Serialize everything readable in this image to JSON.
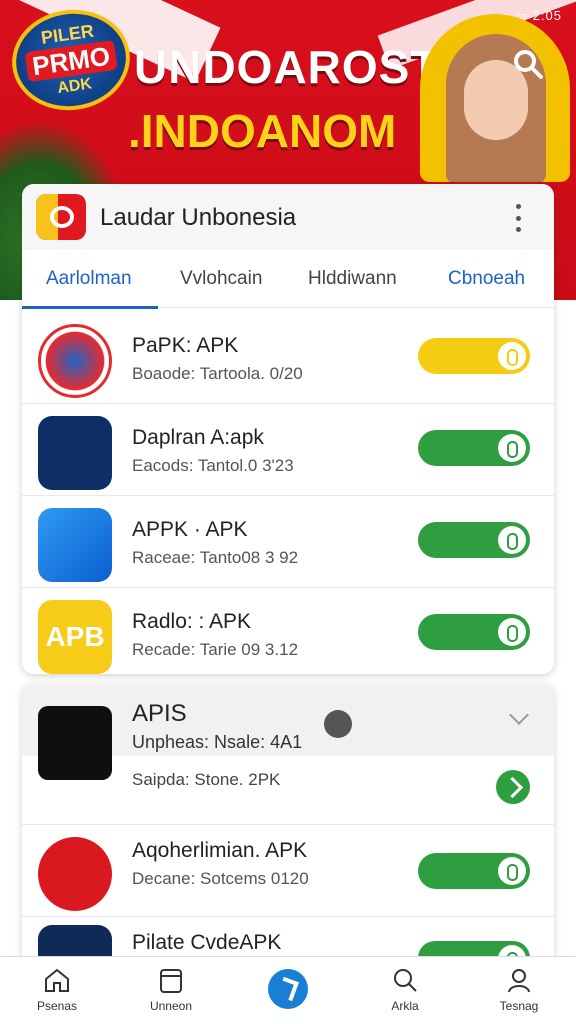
{
  "status_bar": {
    "text": "⋯ ◔ ▭ 2:05"
  },
  "banner": {
    "logo": {
      "line1": "PILER",
      "line2": "PRMO",
      "line3": "ADK"
    },
    "title": "UNDOAROST",
    "subtitle": ".INDOANOM",
    "icons": {
      "search": "search-icon"
    },
    "colors": {
      "background": "#d90f1c",
      "title": "#ffffff",
      "subtitle": "#ffd21a"
    }
  },
  "card": {
    "title": "Laudar Unbonesia",
    "menu_icon": "kebab-menu-icon",
    "tabs": [
      {
        "label": "Aarlolman",
        "active": true
      },
      {
        "label": "Vvlohcain",
        "active": false
      },
      {
        "label": "Hlddiwann",
        "active": false
      },
      {
        "label": "Cbnoeah",
        "active": false
      }
    ],
    "items": [
      {
        "name": "PaPK: APK",
        "detail": "Boaode: Tartoola. 0/20",
        "toggle": "yellow",
        "icon": "badge-logo-icon"
      },
      {
        "name": "Daplran A:apk",
        "detail": "Eacods: Tantol.0 3'23",
        "toggle": "green",
        "icon": "gear-check-icon"
      },
      {
        "name": "APPK · APK",
        "detail": "Raceae: Tanto08 3 92",
        "toggle": "green",
        "icon": "letter-a-icon"
      },
      {
        "name": "Radlo: : APK",
        "detail": "Recade: Tarie 09 3.12",
        "toggle": "green",
        "icon": "apb-icon",
        "icon_text": "APB"
      }
    ]
  },
  "expanded": {
    "name": "APIS",
    "detail1": "Unpheas: Nsale: 4A1",
    "detail2": "Saipda: Stone. 2PK",
    "items": [
      {
        "name": "Aqoherlimian. APK",
        "detail": "Decane: Sotcems 0120",
        "toggle": "green"
      },
      {
        "name": "Pilate CvdeAPK",
        "detail": "",
        "toggle": "green"
      }
    ]
  },
  "bottom_nav": [
    {
      "label": "Psenas",
      "icon": "home-icon"
    },
    {
      "label": "Unneon",
      "icon": "calendar-icon"
    },
    {
      "label": "",
      "icon": "navigate-icon"
    },
    {
      "label": "Arkla",
      "icon": "search-icon"
    },
    {
      "label": "Tesnag",
      "icon": "profile-icon"
    }
  ]
}
